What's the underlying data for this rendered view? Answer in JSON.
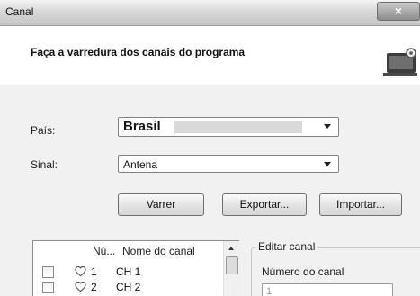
{
  "window": {
    "title": "Canal",
    "close_label": "×"
  },
  "header": {
    "title": "Faça a varredura dos canais do programa",
    "icon": "tv-scan-icon"
  },
  "form": {
    "country_label": "País:",
    "country_value": "Brasil",
    "signal_label": "Sinal:",
    "signal_value": "Antena"
  },
  "buttons": {
    "scan": "Varrer",
    "export": "Exportar...",
    "import": "Importar..."
  },
  "channel_list": {
    "columns": [
      "Nú...",
      "Nome do canal"
    ],
    "rows": [
      {
        "checked": false,
        "icon": "heart-icon",
        "number": "1",
        "name": "CH 1"
      },
      {
        "checked": false,
        "icon": "heart-icon",
        "number": "2",
        "name": "CH 2"
      }
    ]
  },
  "edit_channel": {
    "legend": "Editar canal",
    "number_label": "Número do canal",
    "number_value": "1"
  },
  "colors": {
    "background": "#f1f1f1",
    "header_bg": "#ffffff",
    "titlebar_top": "#f4f4f4",
    "titlebar_bottom": "#c4c4c4",
    "close_button": "#8c8c8c"
  }
}
